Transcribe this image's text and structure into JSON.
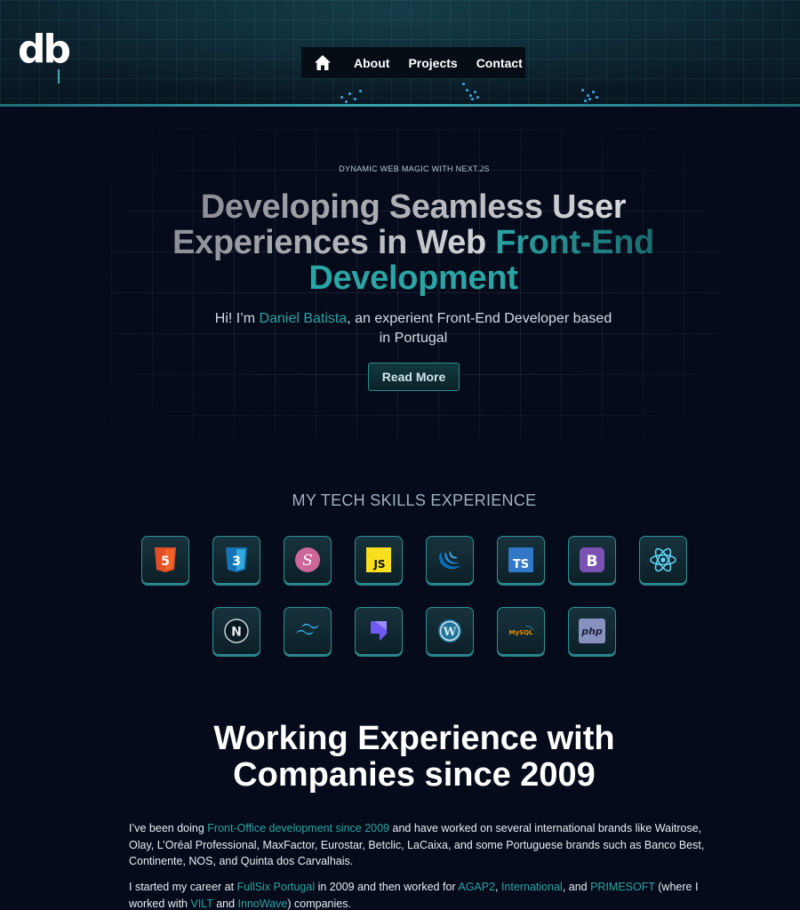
{
  "header": {
    "logo": "db",
    "nav": {
      "home_icon": "home-icon",
      "items": [
        "About",
        "Projects",
        "Contact"
      ]
    }
  },
  "hero": {
    "eyebrow": "DYNAMIC WEB MAGIC WITH NEXT.JS",
    "title_part1": "Developing Seamless User",
    "title_part2": "Experiences in Web ",
    "title_part3": "Front-End",
    "title_part4": "Development",
    "sub_prefix": "Hi! I’m ",
    "sub_name": "Daniel Batista",
    "sub_suffix": ", an experient Front-End Developer based in Portugal",
    "button": "Read More"
  },
  "skills": {
    "title": "MY TECH SKILLS EXPERIENCE",
    "items": [
      {
        "name": "html5-icon",
        "label": "5"
      },
      {
        "name": "css3-icon",
        "label": "3"
      },
      {
        "name": "sass-icon",
        "label": "S"
      },
      {
        "name": "javascript-icon",
        "label": "JS"
      },
      {
        "name": "jquery-icon",
        "label": ""
      },
      {
        "name": "typescript-icon",
        "label": "TS"
      },
      {
        "name": "bootstrap-icon",
        "label": "B"
      },
      {
        "name": "react-icon",
        "label": ""
      },
      {
        "name": "nextjs-icon",
        "label": "N"
      },
      {
        "name": "tailwind-icon",
        "label": ""
      },
      {
        "name": "stackbit-icon",
        "label": ""
      },
      {
        "name": "wordpress-icon",
        "label": "W"
      },
      {
        "name": "mysql-icon",
        "label": "MySQL"
      },
      {
        "name": "php-icon",
        "label": "php"
      }
    ]
  },
  "experience": {
    "title_line1": "Working Experience with",
    "title_line2": "Companies since 2009",
    "p1_a": "I’ve been doing ",
    "p1_hl": "Front-Office development since 2009",
    "p1_b": " and have worked on several international brands like Waitrose, Olay, L’Oréal Professional, MaxFactor, Eurostar, Betclic, LaCaixa, and some Portuguese brands such as Banco Best, Continente, NOS, and Quinta dos Carvalhais.",
    "p2_a": "I started my career at ",
    "p2_hl1": "FullSix Portugal",
    "p2_b": " in 2009 and then worked for ",
    "p2_hl2": "AGAP2",
    "p2_c": ", ",
    "p2_hl3": "International",
    "p2_d": ", and ",
    "p2_hl4": "PRIMESOFT",
    "p2_e": " (where I worked with ",
    "p2_hl5": "VILT",
    "p2_f": " and ",
    "p2_hl6": "InnoWave",
    "p2_g": ") companies."
  },
  "colors": {
    "background": "#050b1a",
    "accent": "#2aa4a4",
    "nav_bg": "#060d14"
  }
}
